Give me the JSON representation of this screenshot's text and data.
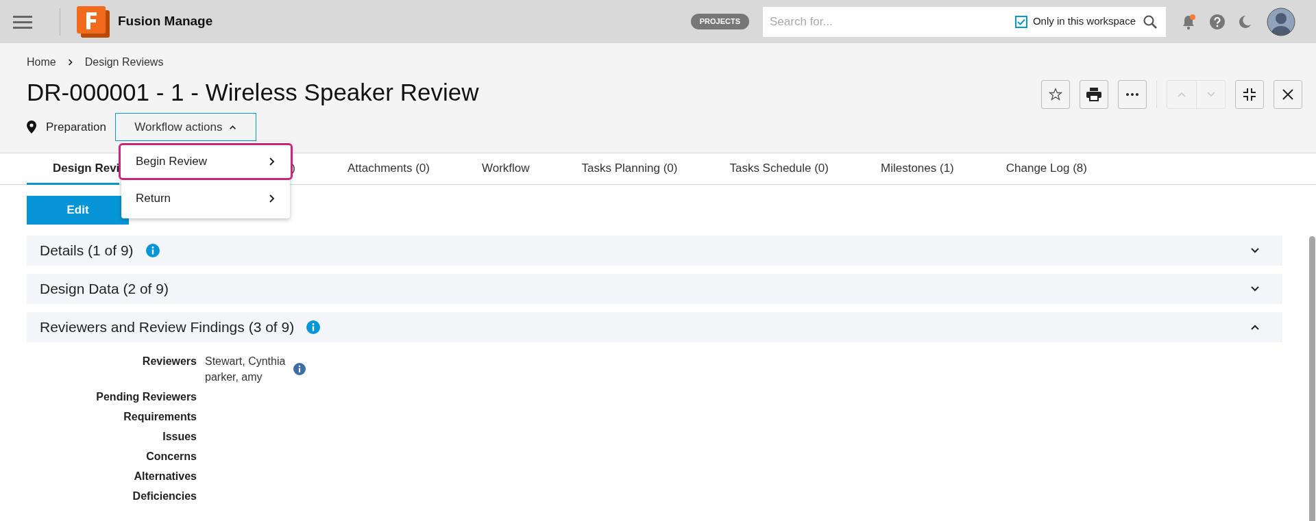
{
  "topbar": {
    "app_name": "Fusion Manage",
    "projects_badge": "PROJECTS",
    "search": {
      "placeholder": "Search for...",
      "scope_label": "Only in this workspace",
      "scope_checked": true
    },
    "notifications_unread": true
  },
  "breadcrumb": [
    "Home",
    "Design Reviews"
  ],
  "title": "DR-000001 - 1 - Wireless Speaker Review",
  "state_label": "Preparation",
  "workflow_button": {
    "label": "Workflow actions",
    "expanded": true
  },
  "workflow_menu": [
    {
      "label": "Begin Review",
      "selected": true
    },
    {
      "label": "Return",
      "selected": false
    }
  ],
  "nav_buttons": {
    "disabled": true
  },
  "tabs": [
    {
      "label": "Design Revi",
      "selected": true
    },
    {
      "label": ")",
      "selected": false
    },
    {
      "label": "Attachments (0)",
      "selected": false
    },
    {
      "label": "Workflow",
      "selected": false
    },
    {
      "label": "Tasks Planning (0)",
      "selected": false
    },
    {
      "label": "Tasks Schedule (0)",
      "selected": false
    },
    {
      "label": "Milestones (1)",
      "selected": false
    },
    {
      "label": "Change Log (8)",
      "selected": false
    }
  ],
  "edit_button": "Edit",
  "sections": [
    {
      "title": "Details (1 of 9)",
      "info": true,
      "expanded": false
    },
    {
      "title": "Design Data (2 of 9)",
      "info": false,
      "expanded": false
    },
    {
      "title": "Reviewers and Review Findings (3 of 9)",
      "info": true,
      "expanded": true
    }
  ],
  "fields": [
    {
      "label": "Reviewers",
      "values": [
        "Stewart, Cynthia",
        "parker, amy"
      ],
      "info": true
    },
    {
      "label": "Pending Reviewers"
    },
    {
      "label": "Requirements"
    },
    {
      "label": "Issues"
    },
    {
      "label": "Concerns"
    },
    {
      "label": "Alternatives"
    },
    {
      "label": "Deficiencies"
    }
  ]
}
